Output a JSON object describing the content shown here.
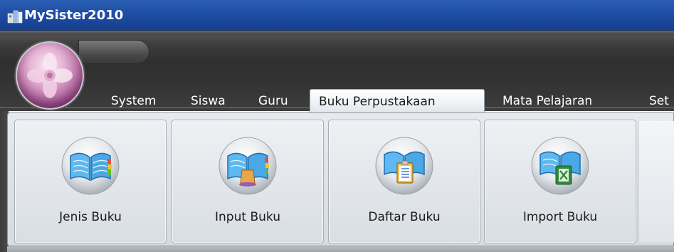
{
  "window": {
    "title": "MySister2010",
    "icon": "app-icon"
  },
  "tabs": [
    {
      "label": "System"
    },
    {
      "label": "Siswa"
    },
    {
      "label": "Guru"
    },
    {
      "label": "Buku Perpustakaan",
      "active": true
    },
    {
      "label": "Mata Pelajaran"
    },
    {
      "label": "Set"
    }
  ],
  "ribbon": {
    "buttons": [
      {
        "label": "Jenis Buku",
        "icon": "open-book-icon"
      },
      {
        "label": "Input Buku",
        "icon": "book-input-icon"
      },
      {
        "label": "Daftar Buku",
        "icon": "book-list-icon"
      },
      {
        "label": "Import Buku",
        "icon": "book-import-excel-icon"
      }
    ]
  },
  "colors": {
    "titlebar": "#1f4fa6",
    "ribbon_dark": "#323232",
    "ribbon_body": "#dfe3e8",
    "orb": "#b870a4",
    "icon_blue": "#4aa8e6"
  }
}
